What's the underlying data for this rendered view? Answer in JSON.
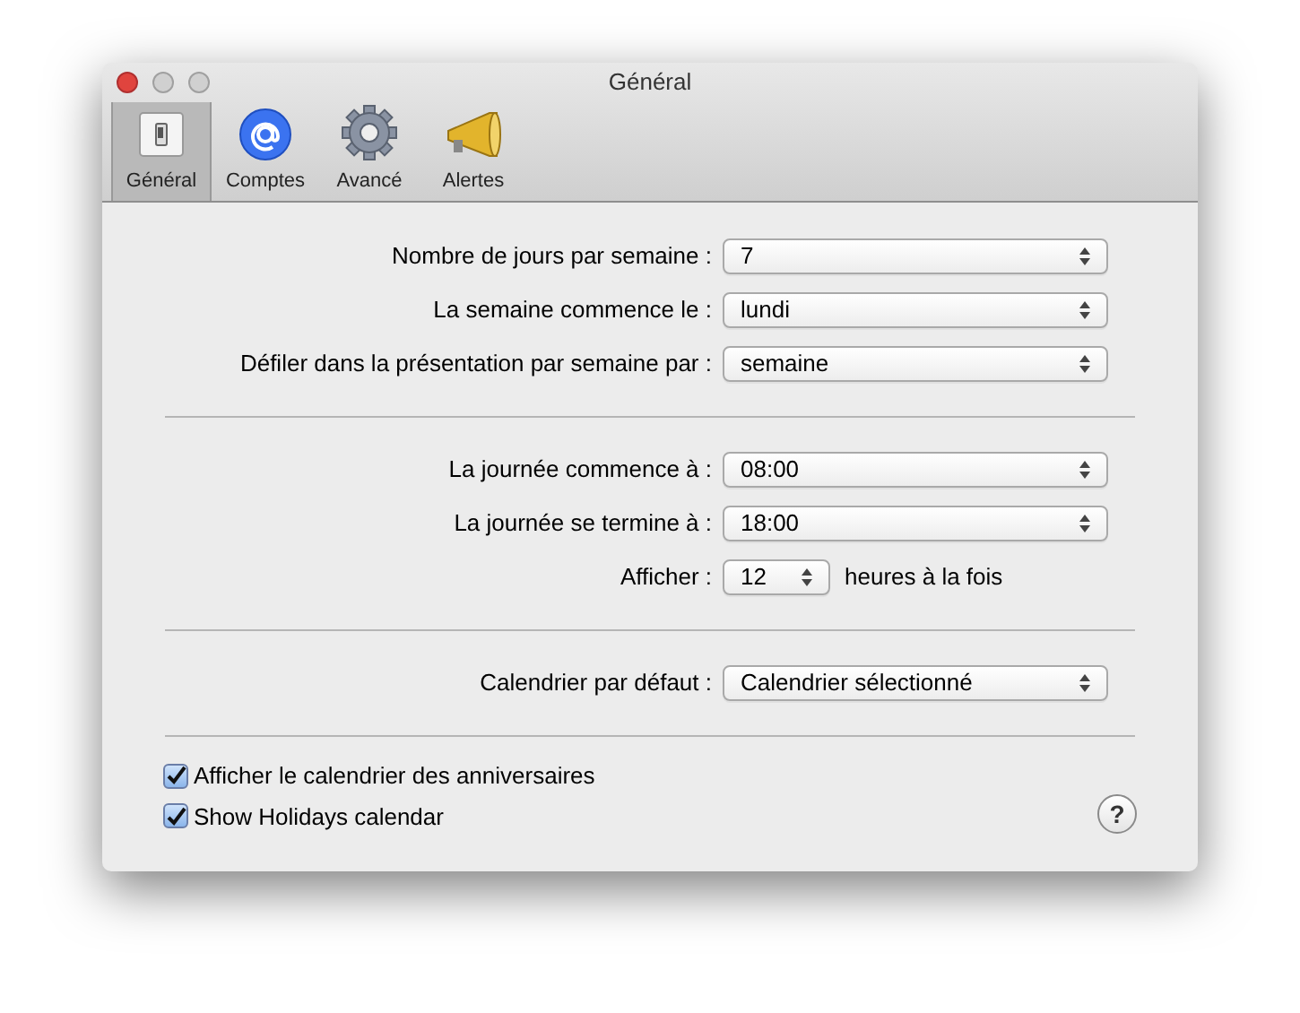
{
  "window": {
    "title": "Général"
  },
  "toolbar": [
    {
      "label": "Général",
      "selected": true,
      "kind": "switch"
    },
    {
      "label": "Comptes",
      "selected": false,
      "kind": "at"
    },
    {
      "label": "Avancé",
      "selected": false,
      "kind": "gear"
    },
    {
      "label": "Alertes",
      "selected": false,
      "kind": "megaphone"
    }
  ],
  "sections": [
    [
      {
        "label": "Nombre de jours par semaine :",
        "value": "7",
        "kind": "popup"
      },
      {
        "label": "La semaine commence le :",
        "value": "lundi",
        "kind": "popup"
      },
      {
        "label": "Défiler dans la présentation par semaine par :",
        "value": "semaine",
        "kind": "popup"
      }
    ],
    [
      {
        "label": "La journée commence à :",
        "value": "08:00",
        "kind": "popup"
      },
      {
        "label": "La journée se termine à :",
        "value": "18:00",
        "kind": "popup"
      },
      {
        "label": "Afficher :",
        "value": "12",
        "kind": "small_popup",
        "suffix": "heures à la fois"
      }
    ],
    [
      {
        "label": "Calendrier par défaut :",
        "value": "Calendrier sélectionné",
        "kind": "popup"
      }
    ]
  ],
  "checkboxes": [
    {
      "label": "Afficher le calendrier des anniversaires",
      "checked": true
    },
    {
      "label": "Show Holidays calendar",
      "checked": true
    }
  ],
  "help": "?"
}
